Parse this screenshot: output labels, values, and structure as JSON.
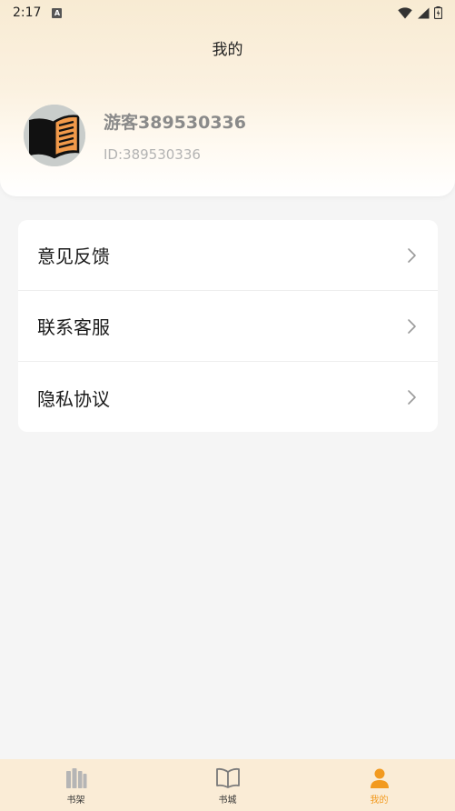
{
  "status_bar": {
    "time": "2:17",
    "notification_letter": "A"
  },
  "header": {
    "title": "我的"
  },
  "profile": {
    "username": "游客389530336",
    "user_id": "ID:389530336"
  },
  "menu": {
    "items": [
      {
        "label": "意见反馈"
      },
      {
        "label": "联系客服"
      },
      {
        "label": "隐私协议"
      }
    ]
  },
  "tab_bar": {
    "tabs": [
      {
        "label": "书架",
        "icon": "bookshelf-icon"
      },
      {
        "label": "书城",
        "icon": "open-book-icon"
      },
      {
        "label": "我的",
        "icon": "user-icon",
        "active": true
      }
    ]
  },
  "colors": {
    "accent": "#f29a1f",
    "header_bg": "#f8ebd3",
    "tab_bar_bg": "#faecd6",
    "page_bg": "#f5f5f5"
  }
}
